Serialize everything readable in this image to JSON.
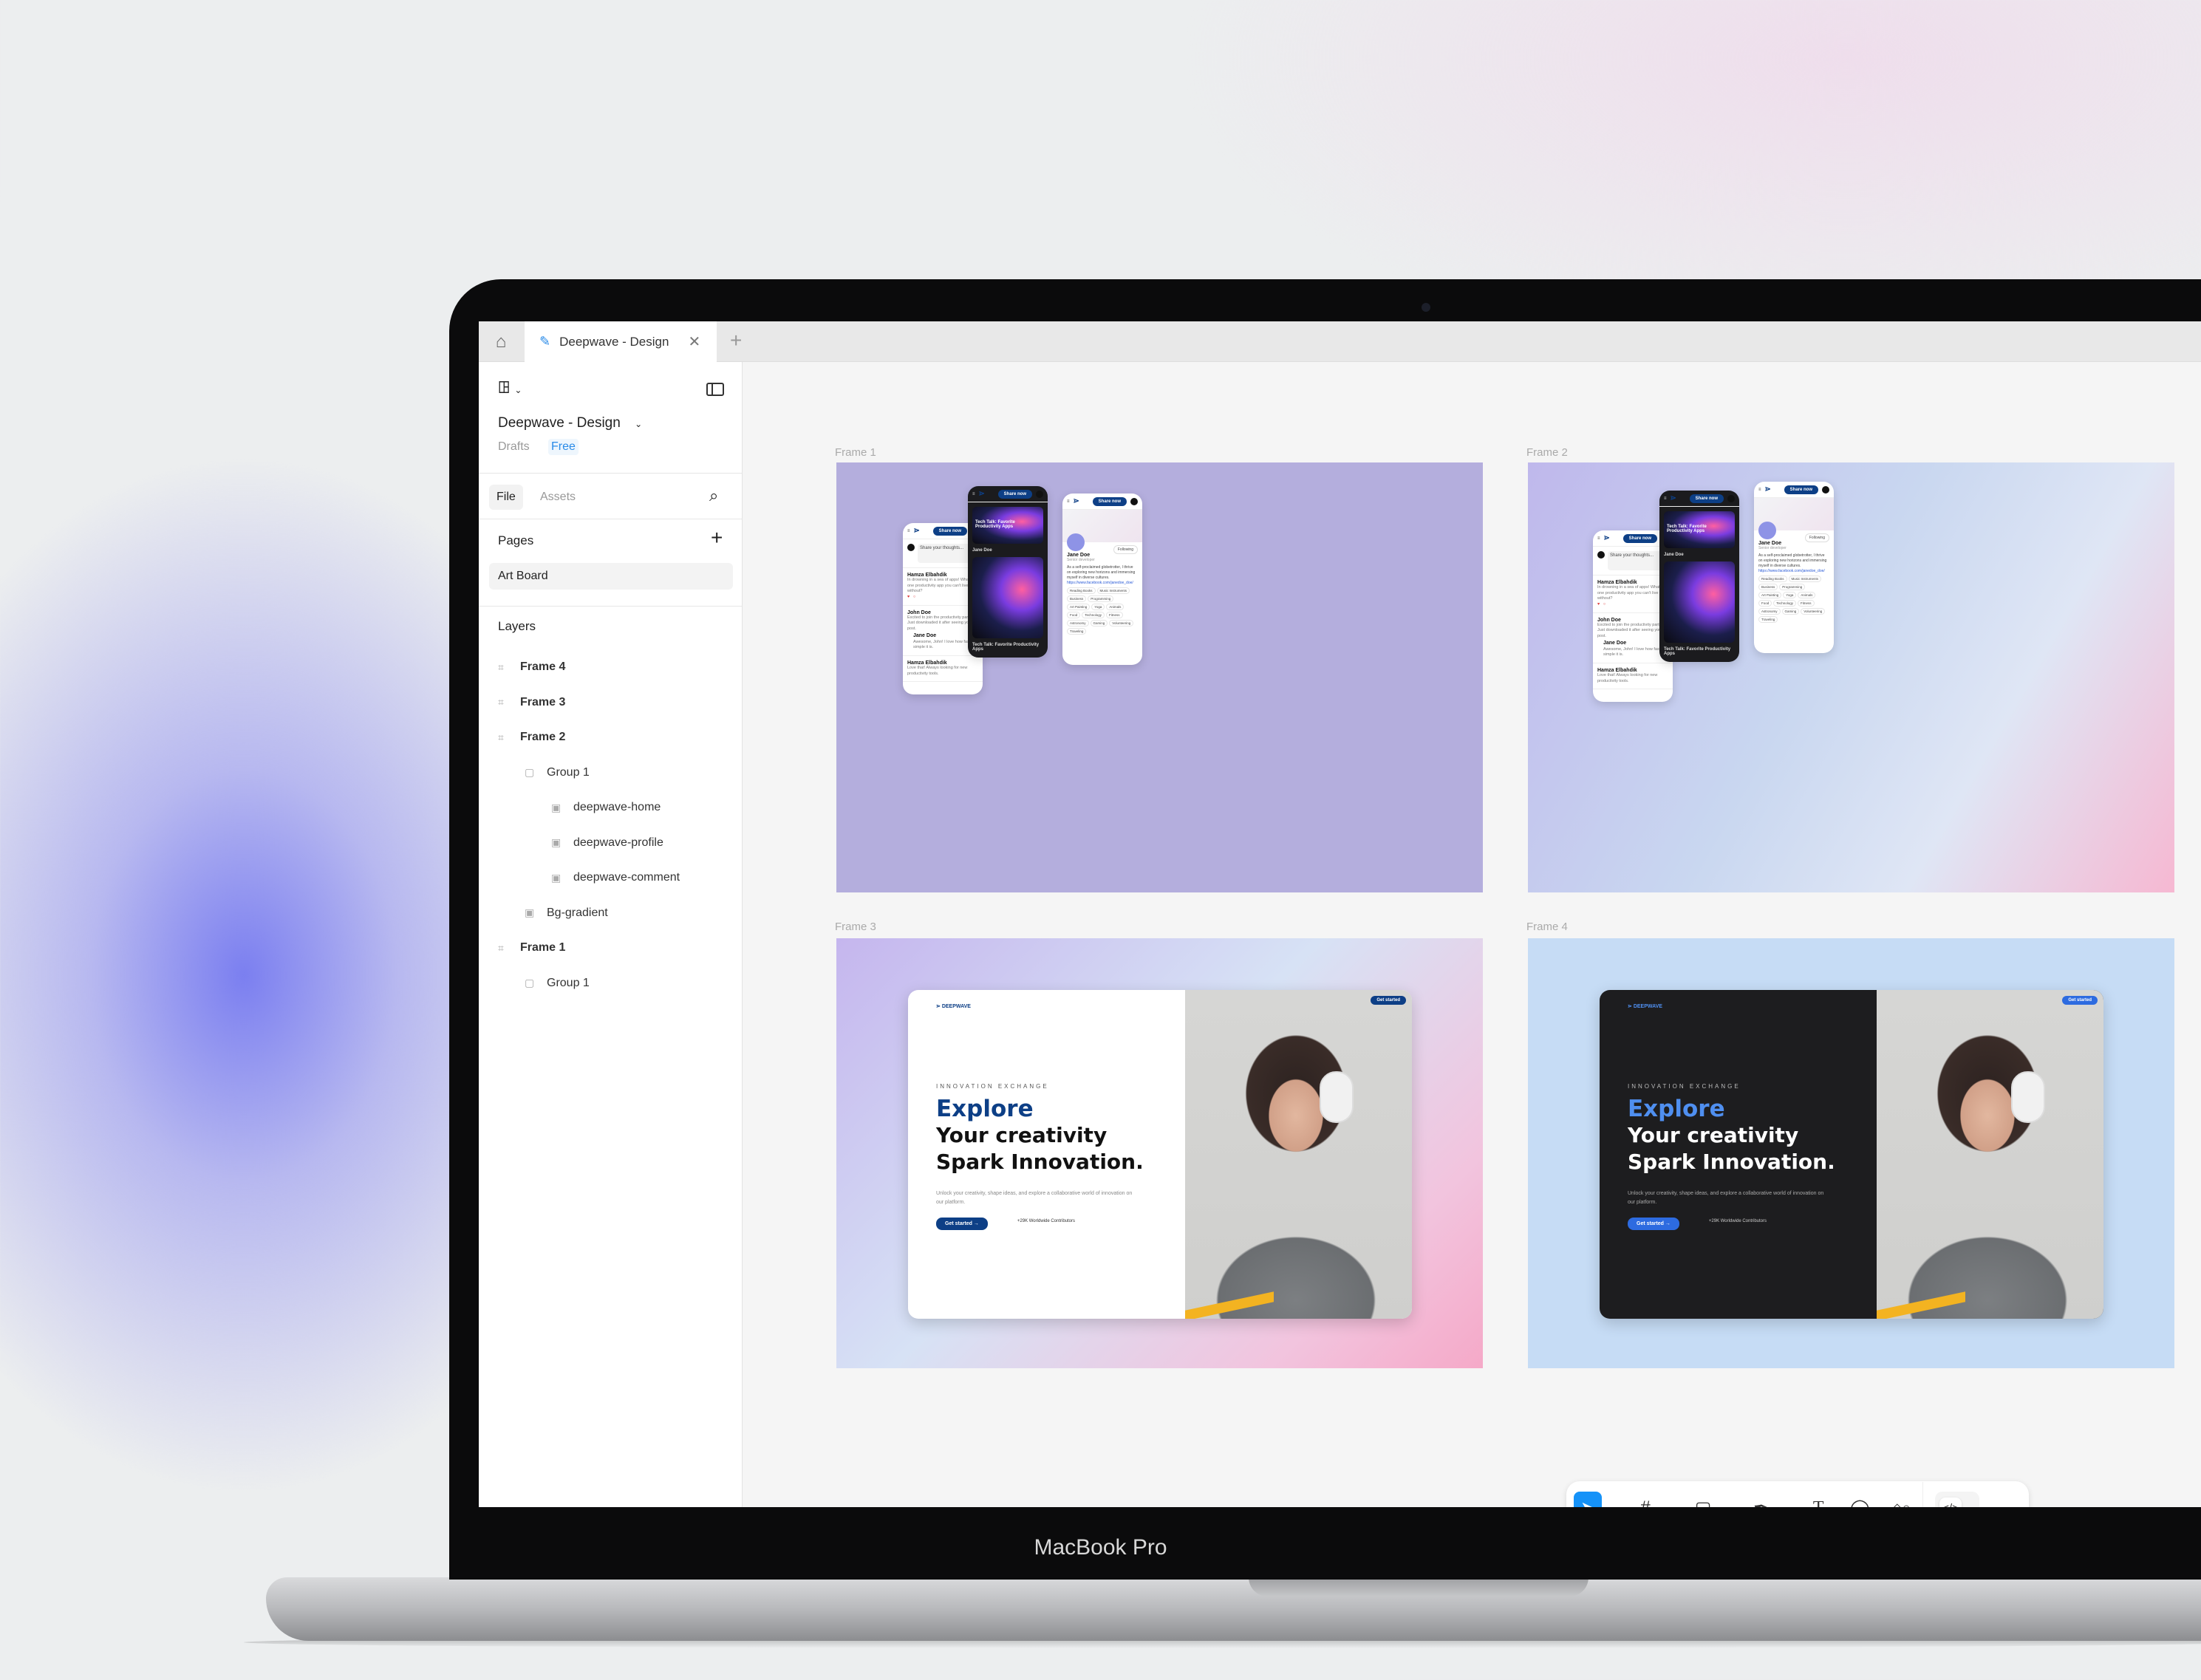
{
  "device_label": "MacBook Pro",
  "tabs": {
    "home_icon": "home-icon",
    "active_tab": "Deepwave - Design",
    "add_icon": "plus-icon"
  },
  "sidebar": {
    "file_name": "Deepwave - Design",
    "location": "Drafts",
    "plan_badge": "Free",
    "tab_file": "File",
    "tab_assets": "Assets",
    "pages_heading": "Pages",
    "pages": [
      "Art Board"
    ],
    "layers_heading": "Layers",
    "layers": [
      {
        "label": "Frame 4",
        "type": "frame"
      },
      {
        "label": "Frame 3",
        "type": "frame"
      },
      {
        "label": "Frame 2",
        "type": "frame"
      },
      {
        "label": "Group 1",
        "type": "group"
      },
      {
        "label": "deepwave-home",
        "type": "image"
      },
      {
        "label": "deepwave-profile",
        "type": "image"
      },
      {
        "label": "deepwave-comment",
        "type": "image"
      },
      {
        "label": "Bg-gradient",
        "type": "image"
      },
      {
        "label": "Frame 1",
        "type": "frame"
      },
      {
        "label": "Group 1",
        "type": "group"
      }
    ]
  },
  "canvas": {
    "frames": [
      "Frame 1",
      "Frame 2",
      "Frame 3",
      "Frame 4"
    ],
    "mockup": {
      "share_button": "Share now",
      "comment_placeholder": "Share your thoughts...",
      "post1_author": "Hamza Elbahdik",
      "post2_author": "John Doe",
      "post3_author": "Jane Doe",
      "card_title": "Tech Talk: Favorite Productivity Apps",
      "profile_name": "Jane Doe",
      "profile_role": "Senior developer",
      "follow_button": "Following",
      "profile_link": "https://www.facebook.com/janedoe_doe/",
      "interests": [
        "Reading Books",
        "Music Instruments",
        "Business",
        "Programming",
        "Art Painting",
        "Yoga",
        "Animals",
        "Food",
        "Technology",
        "Fitness",
        "Astronomy",
        "Gaming",
        "Volunteering",
        "Traveling"
      ],
      "brand": "DEEPWAVE",
      "hero_cta_top": "Get started",
      "eyebrow": "INNOVATION  EXCHANGE",
      "headline_1": "Explore",
      "headline_2": "Your creativity",
      "headline_3": "Spark Innovation.",
      "subtext": "Unlock your creativity, shape ideas, and explore a collaborative world of innovation on our platform.",
      "cta": "Get started →",
      "contributors": "+29K Worldwide Contributors"
    }
  },
  "toolbar": {
    "tools": [
      "move",
      "frame",
      "rectangle",
      "pen",
      "text",
      "comment",
      "actions",
      "dev-mode"
    ],
    "active": "move",
    "accent": "#1592f8"
  }
}
